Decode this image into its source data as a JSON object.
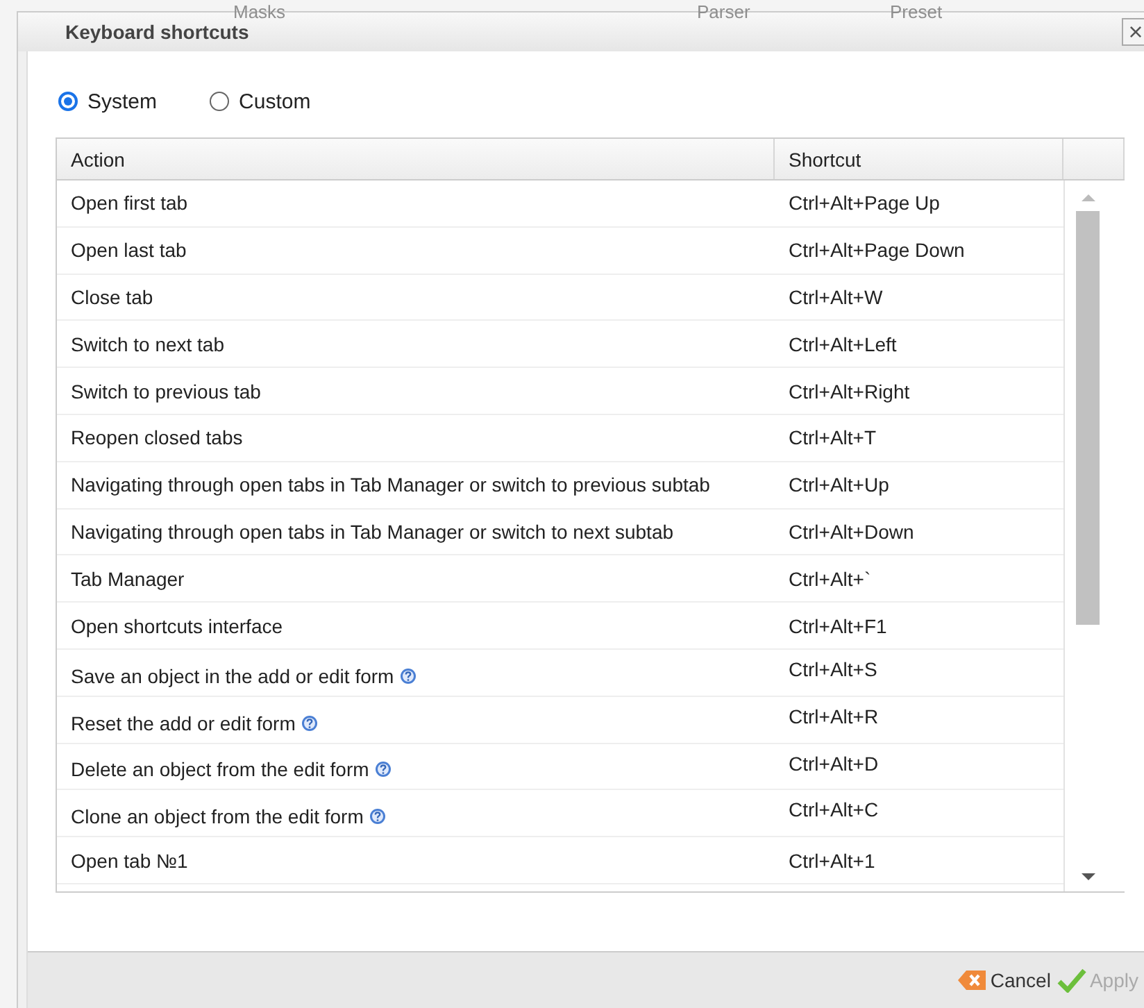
{
  "background_labels": [
    "Masks",
    "Parser",
    "Preset"
  ],
  "dialog": {
    "title": "Keyboard shortcuts",
    "close": "×"
  },
  "modes": [
    {
      "label": "System",
      "selected": true
    },
    {
      "label": "Custom",
      "selected": false
    }
  ],
  "table": {
    "columns": [
      "Action",
      "Shortcut"
    ],
    "rows": [
      {
        "action": "Open first tab",
        "shortcut": "Ctrl+Alt+Page Up",
        "help": false
      },
      {
        "action": "Open last tab",
        "shortcut": "Ctrl+Alt+Page Down",
        "help": false
      },
      {
        "action": "Close tab",
        "shortcut": "Ctrl+Alt+W",
        "help": false
      },
      {
        "action": "Switch to next tab",
        "shortcut": "Ctrl+Alt+Left",
        "help": false
      },
      {
        "action": "Switch to previous tab",
        "shortcut": "Ctrl+Alt+Right",
        "help": false
      },
      {
        "action": "Reopen closed tabs",
        "shortcut": "Ctrl+Alt+T",
        "help": false
      },
      {
        "action": "Navigating through open tabs in Tab Manager or switch to previous subtab",
        "shortcut": "Ctrl+Alt+Up",
        "help": false
      },
      {
        "action": "Navigating through open tabs in Tab Manager or switch to next subtab",
        "shortcut": "Ctrl+Alt+Down",
        "help": false
      },
      {
        "action": "Tab Manager",
        "shortcut": "Ctrl+Alt+`",
        "help": false
      },
      {
        "action": "Open shortcuts interface",
        "shortcut": "Ctrl+Alt+F1",
        "help": false
      },
      {
        "action": "Save an object in the add or edit form",
        "shortcut": "Ctrl+Alt+S",
        "help": true
      },
      {
        "action": "Reset the add or edit form",
        "shortcut": "Ctrl+Alt+R",
        "help": true
      },
      {
        "action": "Delete an object from the edit form",
        "shortcut": "Ctrl+Alt+D",
        "help": true
      },
      {
        "action": "Clone an object from the edit form",
        "shortcut": "Ctrl+Alt+C",
        "help": true
      },
      {
        "action": "Open tab №1",
        "shortcut": "Ctrl+Alt+1",
        "help": false
      }
    ]
  },
  "buttons": [
    {
      "label": "Cancel",
      "kind": "cancel",
      "disabled": false
    },
    {
      "label": "Apply",
      "kind": "apply",
      "disabled": true
    }
  ]
}
